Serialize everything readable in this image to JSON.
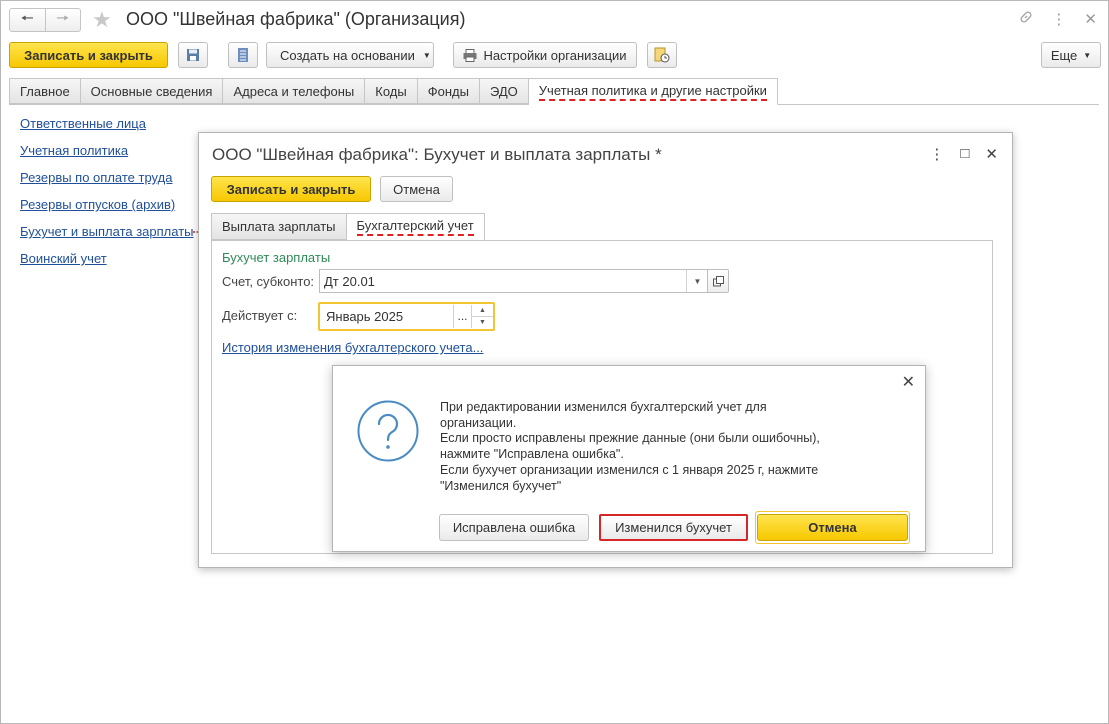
{
  "window": {
    "title": "ООО \"Швейная фабрика\" (Организация)",
    "back_icon": "arrow-left-icon",
    "forward_icon": "arrow-right-icon",
    "favorite_icon": "star-icon",
    "link_icon": "link-icon",
    "more_icon": "vertical-dots-icon",
    "close_icon": "close-icon"
  },
  "toolbar": {
    "save_close_label": "Записать и закрыть",
    "create_based_label": "Создать на основании",
    "org_settings_label": "Настройки организации",
    "more_label": "Еще"
  },
  "main_tabs": [
    {
      "label": "Главное"
    },
    {
      "label": "Основные сведения"
    },
    {
      "label": "Адреса и телефоны"
    },
    {
      "label": "Коды"
    },
    {
      "label": "Фонды"
    },
    {
      "label": "ЭДО"
    },
    {
      "label": "Учетная политика и другие настройки",
      "active": true
    }
  ],
  "side_links": [
    {
      "label": "Ответственные лица"
    },
    {
      "label": "Учетная политика"
    },
    {
      "label": "Резервы по оплате труда"
    },
    {
      "label": "Резервы отпусков (архив)"
    },
    {
      "label": "Бухучет и выплата зарплаты"
    },
    {
      "label": "Воинский учет"
    }
  ],
  "subwindow": {
    "title": "ООО \"Швейная фабрика\": Бухучет и выплата зарплаты *",
    "save_close_label": "Записать и закрыть",
    "cancel_label": "Отмена",
    "tabs": [
      {
        "label": "Выплата зарплаты"
      },
      {
        "label": "Бухгалтерский учет",
        "active": true
      }
    ],
    "group_title": "Бухучет зарплаты",
    "account_label": "Счет, субконто:",
    "account_value": "Дт 20.01",
    "effective_label": "Действует с:",
    "effective_value": "Январь 2025",
    "effective_dots": "...",
    "history_link": "История изменения бухгалтерского учета..."
  },
  "dialog": {
    "icon": "question-icon",
    "lines": [
      "При редактировании изменился бухгалтерский учет для",
      "организации.",
      "Если просто исправлены прежние данные (они были ошибочны),",
      "нажмите \"Исправлена ошибка\".",
      "Если бухучет организации изменился с 1 января 2025 г, нажмите",
      "\"Изменился бухучет\""
    ],
    "btn_fixed_error": "Исправлена ошибка",
    "btn_changed": "Изменился бухучет",
    "btn_cancel": "Отмена"
  },
  "colors": {
    "accent_yellow": "#f7c800",
    "link_blue": "#1f4f9a",
    "group_green": "#2e8b57",
    "highlight_red": "#d42828",
    "question_blue": "#4a8bc4"
  }
}
